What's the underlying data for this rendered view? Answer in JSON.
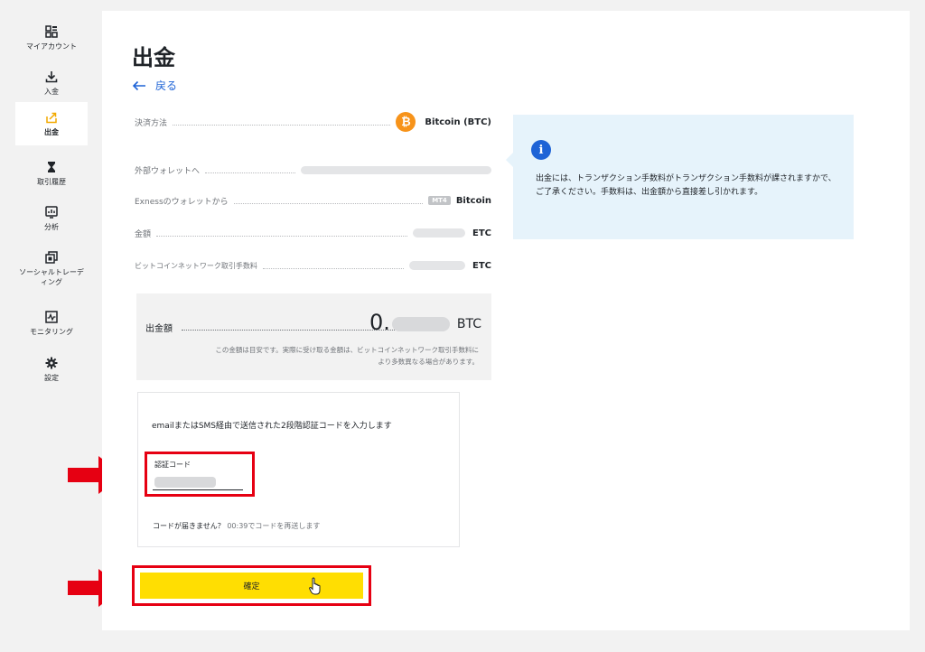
{
  "sidebar": {
    "items": [
      {
        "label": "マイアカウント",
        "icon": "dashboard-icon"
      },
      {
        "label": "入金",
        "icon": "download-icon"
      },
      {
        "label": "出金",
        "icon": "upload-icon",
        "active": true
      },
      {
        "label": "取引履歴",
        "icon": "hourglass-icon"
      },
      {
        "label": "分析",
        "icon": "chart-icon"
      },
      {
        "label": "ソーシャルトレーディング",
        "icon": "social-icon"
      },
      {
        "label": "モニタリング",
        "icon": "monitor-icon"
      },
      {
        "label": "設定",
        "icon": "gear-icon"
      }
    ]
  },
  "page": {
    "title": "出金",
    "back_label": "戻る"
  },
  "details": {
    "payment_method_label": "決済方法",
    "payment_method_value": "Bitcoin (BTC)",
    "external_wallet_label": "外部ウォレットへ",
    "from_wallet_label": "Exnessのウォレットから",
    "from_wallet_badge": "MT4",
    "from_wallet_value": "Bitcoin",
    "amount_label": "金額",
    "amount_unit": "ETC",
    "fee_label": "ビットコインネットワーク取引手数料",
    "fee_unit": "ETC"
  },
  "info": {
    "icon": "i",
    "text_line1": "出金には、トランザクション手数料がトランザクション手数料が課されますかで、",
    "text_line2": "ご了承ください。手数料は、出金額から直接差し引かれます。"
  },
  "summary": {
    "label": "出金額",
    "value_prefix": "0.",
    "unit": "BTC",
    "note_line1": "この金額は目安です。実際に受け取る金額は、ビットコインネットワーク取引手数料に",
    "note_line2": "より多数異なる場合があります。"
  },
  "verification": {
    "instruction": "emailまたはSMS経由で送信された2段階認証コードを入力します",
    "code_label": "認証コード",
    "resend_prompt": "コードが届きません？",
    "resend_timer": "00:39でコードを再送します"
  },
  "confirm": {
    "label": "確定"
  },
  "colors": {
    "accent_blue": "#1e63d6",
    "highlight_red": "#e60012",
    "button_yellow": "#ffde02",
    "btc_orange": "#f7931a",
    "info_bg": "#e6f3fb"
  }
}
